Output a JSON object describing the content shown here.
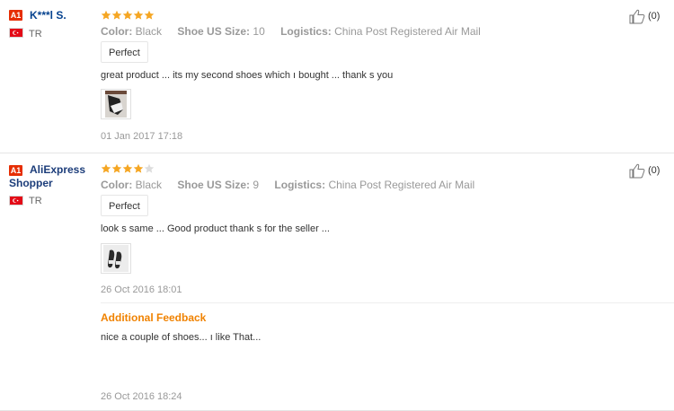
{
  "reviews": [
    {
      "badge": "A1",
      "user": "K***l S.",
      "country": "TR",
      "rating": 5,
      "max_rating": 5,
      "color_label": "Color:",
      "color_value": "Black",
      "size_label": "Shoe US Size:",
      "size_value": "10",
      "logistics_label": "Logistics:",
      "logistics_value": "China Post Registered Air Mail",
      "tag": "Perfect",
      "text": "great product ... its my second shoes which ı bought ... thank s you",
      "date": "01 Jan 2017 17:18",
      "likes": "(0)"
    },
    {
      "badge": "A1",
      "user": "AliExpress Shopper",
      "country": "TR",
      "rating": 4,
      "max_rating": 5,
      "color_label": "Color:",
      "color_value": "Black",
      "size_label": "Shoe US Size:",
      "size_value": "9",
      "logistics_label": "Logistics:",
      "logistics_value": "China Post Registered Air Mail",
      "tag": "Perfect",
      "text": "look s same ... Good product thank s for the seller ...",
      "date": "26 Oct 2016 18:01",
      "likes": "(0)",
      "additional_feedback": {
        "title": "Additional Feedback",
        "text": "nice a couple of shoes... ı like That...",
        "date": "26 Oct 2016 18:24"
      }
    }
  ],
  "colors": {
    "star_filled": "#f5a623",
    "star_empty": "#dddddd",
    "accent_orange": "#f08200",
    "badge_red": "#e62e04"
  }
}
